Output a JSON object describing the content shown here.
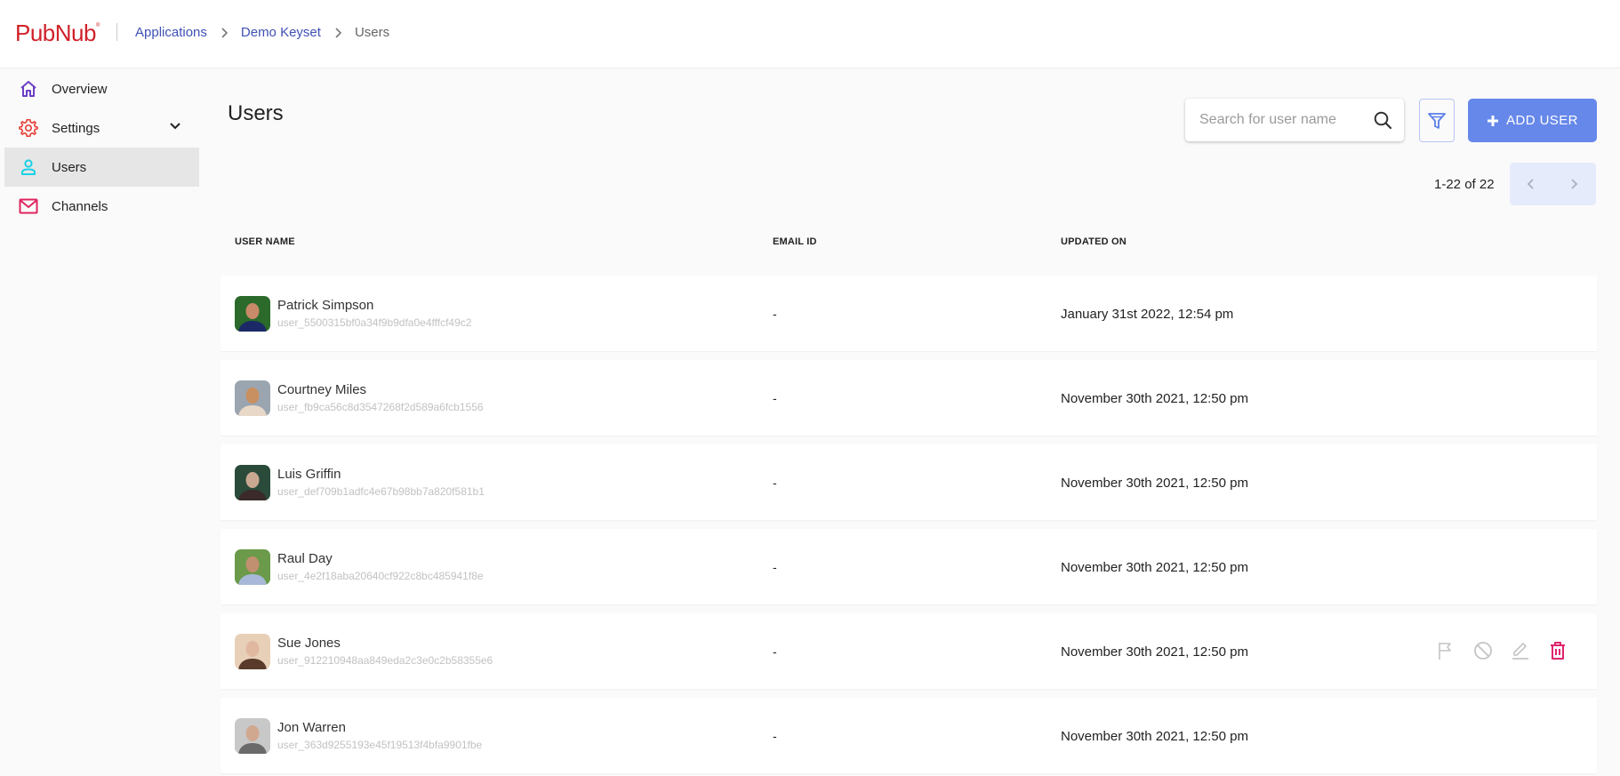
{
  "header": {
    "logo": "PubNub",
    "breadcrumb": [
      {
        "label": "Applications",
        "link": true
      },
      {
        "label": "Demo Keyset",
        "link": true
      },
      {
        "label": "Users",
        "link": false
      }
    ]
  },
  "sidebar": {
    "items": [
      {
        "label": "Overview",
        "icon": "home-icon",
        "color": "#6c3fc4",
        "active": false
      },
      {
        "label": "Settings",
        "icon": "gear-icon",
        "color": "#e8453c",
        "active": false,
        "expandable": true
      },
      {
        "label": "Users",
        "icon": "user-icon",
        "color": "#19d1e6",
        "active": true
      },
      {
        "label": "Channels",
        "icon": "mail-icon",
        "color": "#e0245e",
        "active": false
      }
    ]
  },
  "main": {
    "title": "Users",
    "search": {
      "placeholder": "Search for user name",
      "value": ""
    },
    "add_user_label": "ADD USER",
    "pagination": {
      "text": "1-22 of 22"
    },
    "columns": [
      "USER NAME",
      "EMAIL ID",
      "UPDATED ON"
    ],
    "users": [
      {
        "name": "Patrick Simpson",
        "id": "user_5500315bf0a34f9b9dfa0e4fffcf49c2",
        "email": "-",
        "updated": "January 31st 2022, 12:54 pm",
        "avatar_colors": [
          "#2b6a2a",
          "#1b2a66",
          "#c98a6a"
        ]
      },
      {
        "name": "Courtney Miles",
        "id": "user_fb9ca56c8d3547268f2d589a6fcb1556",
        "email": "-",
        "updated": "November 30th 2021, 12:50 pm",
        "avatar_colors": [
          "#9aa5b0",
          "#e8d8c8",
          "#c89060"
        ]
      },
      {
        "name": "Luis Griffin",
        "id": "user_def709b1adfc4e67b98bb7a820f581b1",
        "email": "-",
        "updated": "November 30th 2021, 12:50 pm",
        "avatar_colors": [
          "#2a4a3a",
          "#3a2a2a",
          "#c8a890"
        ]
      },
      {
        "name": "Raul Day",
        "id": "user_4e2f18aba20640cf922c8bc485941f8e",
        "email": "-",
        "updated": "November 30th 2021, 12:50 pm",
        "avatar_colors": [
          "#6a9a4a",
          "#a8b8d8",
          "#c09070"
        ]
      },
      {
        "name": "Sue Jones",
        "id": "user_912210948aa849eda2c3e0c2b58355e6",
        "email": "-",
        "updated": "November 30th 2021, 12:50 pm",
        "avatar_colors": [
          "#e8d0b8",
          "#5a3a2a",
          "#e0b8a0"
        ],
        "hovered": true
      },
      {
        "name": "Jon Warren",
        "id": "user_363d9255193e45f19513f4bfa9901fbe",
        "email": "-",
        "updated": "November 30th 2021, 12:50 pm",
        "avatar_colors": [
          "#c8c8c8",
          "#6a6a6a",
          "#d0a890"
        ]
      }
    ],
    "row_actions": [
      {
        "icon": "flag-icon",
        "color": "#c4c4c4"
      },
      {
        "icon": "block-icon",
        "color": "#c4c4c4"
      },
      {
        "icon": "edit-icon",
        "color": "#c4c4c4"
      },
      {
        "icon": "trash-icon",
        "color": "#e0246e"
      }
    ]
  },
  "colors": {
    "brand": "#d02129",
    "link": "#3f51b5",
    "primary": "#6688ea",
    "pager_bg": "#e6ebfb",
    "active_nav": "#e6e6e6"
  }
}
